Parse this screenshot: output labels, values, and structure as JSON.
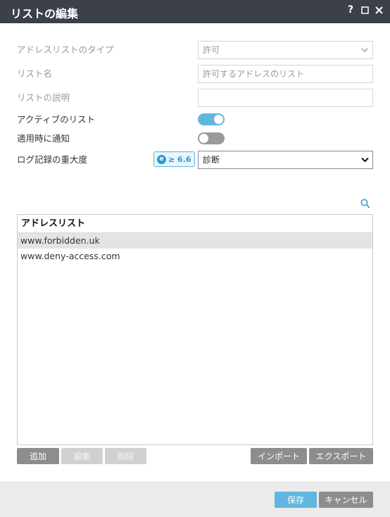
{
  "window": {
    "title": "リストの編集",
    "help_icon": "?"
  },
  "form": {
    "type_label": "アドレスリストのタイプ",
    "type_value": "許可",
    "name_label": "リスト名",
    "name_value": "許可するアドレスのリスト",
    "desc_label": "リストの説明",
    "desc_value": "",
    "active_label": "アクティブのリスト",
    "active_on": true,
    "notify_label": "適用時に通知",
    "notify_on": false,
    "severity_label": "ログ記録の重大度",
    "severity_badge": "≥ 6.6",
    "severity_badge_icon": "e",
    "severity_value": "診断"
  },
  "table": {
    "header": "アドレスリスト",
    "rows": [
      "www.forbidden.uk",
      "www.deny-access.com"
    ],
    "selected_row": 0
  },
  "buttons": {
    "add": "追加",
    "edit": "編集",
    "delete": "削除",
    "import": "インポート",
    "export": "エクスポート",
    "save": "保存",
    "cancel": "キャンセル"
  },
  "colors": {
    "titlebar": "#3b4049",
    "accent": "#62b6de",
    "button_gray": "#8d8d8d"
  },
  "icons": [
    "help-icon",
    "maximize-icon",
    "close-icon",
    "chevron-down-icon",
    "search-icon"
  ]
}
